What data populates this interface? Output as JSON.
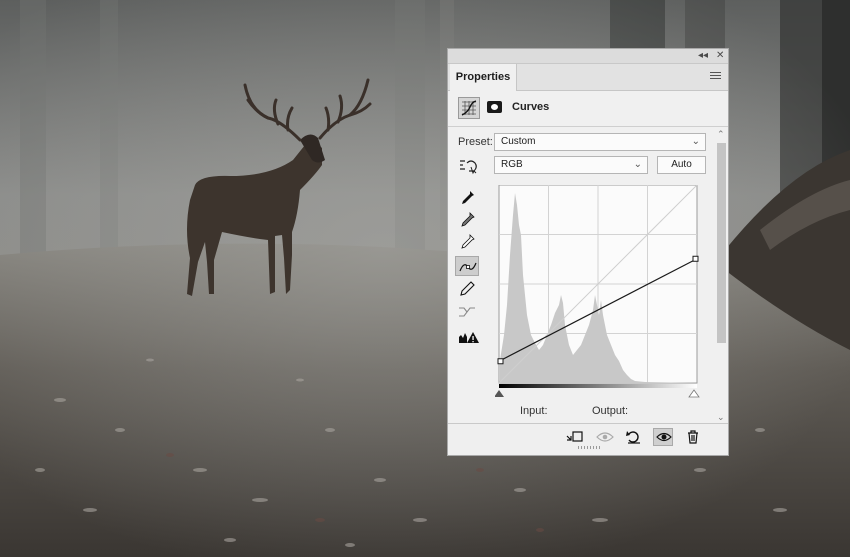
{
  "panel": {
    "tab_label": "Properties",
    "collapse_glyph": "◂◂",
    "close_glyph": "✕",
    "adjustment_title": "Curves",
    "preset_label": "Preset:",
    "preset_value": "Custom",
    "channel_value": "RGB",
    "auto_label": "Auto",
    "input_label": "Input:",
    "output_label": "Output:",
    "tools": [
      "sample-in-image-icon",
      "black-point-eyedropper-icon",
      "gray-point-eyedropper-icon",
      "white-point-eyedropper-icon",
      "curve-points-icon",
      "pencil-icon",
      "smooth-icon",
      "clipping-warning-icon"
    ],
    "bottom_icons": [
      "clip-to-layer-icon",
      "view-previous-icon",
      "reset-icon",
      "toggle-visibility-icon",
      "delete-icon"
    ]
  },
  "curve": {
    "points": [
      [
        0,
        28
      ],
      [
        255,
        160
      ]
    ],
    "range": [
      0,
      255
    ]
  },
  "colors": {
    "panel_bg": "#f0f0f0",
    "histogram": "#c8c8c8",
    "curve_line": "#1a1a1a"
  }
}
